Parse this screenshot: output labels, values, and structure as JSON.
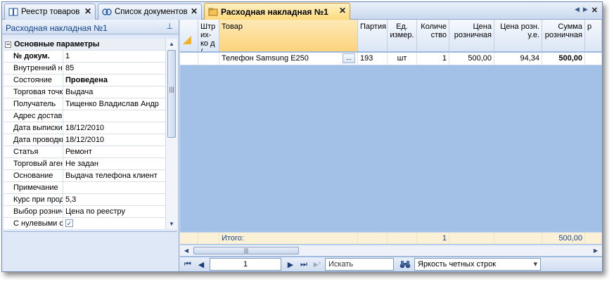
{
  "tabs": [
    {
      "label": "Реестр товаров",
      "icon": "book-icon",
      "close": "✕"
    },
    {
      "label": "Список документов",
      "icon": "chain-icon",
      "close": "✕"
    },
    {
      "label": "Расходная накладная №1",
      "icon": "folder-icon",
      "close": "✕",
      "active": true
    }
  ],
  "tab_nav": {
    "prev": "◀",
    "next": "▶",
    "close": "✕"
  },
  "left_panel": {
    "title": "Расходная накладная №1",
    "pin": "⊥",
    "category": "Основные параметры",
    "category_toggle": "−",
    "checkbox_mark": "✓",
    "rows": [
      {
        "label": "№ докум.",
        "value": "1",
        "bold_label": true
      },
      {
        "label": "Внутренний ном",
        "value": "85"
      },
      {
        "label": "Состояние",
        "value": "Проведена",
        "bold_value": true
      },
      {
        "label": "Торговая точка",
        "value": "Выдача"
      },
      {
        "label": "Получатель",
        "value": "Тищенко Владислав Андр"
      },
      {
        "label": "Адрес доставки",
        "value": ""
      },
      {
        "label": "Дата выписки",
        "value": "18/12/2010"
      },
      {
        "label": "Дата проводки",
        "value": "18/12/2010"
      },
      {
        "label": "Статья",
        "value": "Ремонт"
      },
      {
        "label": "Торговый агент",
        "value": "Не задан"
      },
      {
        "label": "Основание",
        "value": "Выдача телефона клиент"
      },
      {
        "label": "Примечание",
        "value": ""
      },
      {
        "label": "Курс при прода:",
        "value": "5,3"
      },
      {
        "label": "Выбор розничн",
        "value": "Цена по реестру"
      },
      {
        "label": "С нулевыми ост",
        "value": "",
        "checkbox": true
      }
    ]
  },
  "table": {
    "headers": [
      {
        "key": "marker",
        "label": "",
        "w": 26
      },
      {
        "key": "barcode",
        "label": "Штр их-ко д /",
        "w": 30
      },
      {
        "key": "product",
        "label": "Товар",
        "w": 197
      },
      {
        "key": "batch",
        "label": "Партия",
        "w": 42
      },
      {
        "key": "unit",
        "label": "Ед. измер.",
        "w": 42
      },
      {
        "key": "qty",
        "label": "Количе ство",
        "w": 46
      },
      {
        "key": "price",
        "label": "Цена розничная",
        "w": 64
      },
      {
        "key": "price_ue",
        "label": "Цена розн. у.е.",
        "w": 68
      },
      {
        "key": "sum",
        "label": "Сумма розничная",
        "w": 61
      },
      {
        "key": "extra",
        "label": "р",
        "w": 24
      }
    ],
    "rows": [
      {
        "marker": "",
        "barcode": "",
        "product": "Телефон Samsung E250",
        "product_btn": "...",
        "batch": "193",
        "unit": "шт",
        "qty": "1",
        "price": "500,00",
        "price_ue": "94,34",
        "sum": "500,00",
        "extra": ""
      }
    ],
    "totals": {
      "label": "Итого:",
      "qty": "1",
      "sum": "500,00"
    }
  },
  "scroll": {
    "left": "◀",
    "right": "▶",
    "up": "▲",
    "down": "▼",
    "grip": "|||"
  },
  "navigator": {
    "first": "⏮",
    "prev": "◀",
    "page": "1",
    "next": "▶",
    "last": "⏭",
    "new": "▶*",
    "search_placeholder": "Искать",
    "binoculars": "🔭",
    "brightness_label": "Яркость четных строк",
    "dropdown_arrow": "▾"
  },
  "colors": {
    "accent": "#fdd878",
    "selection": "#a3c0e6",
    "header_text": "#15428b"
  }
}
